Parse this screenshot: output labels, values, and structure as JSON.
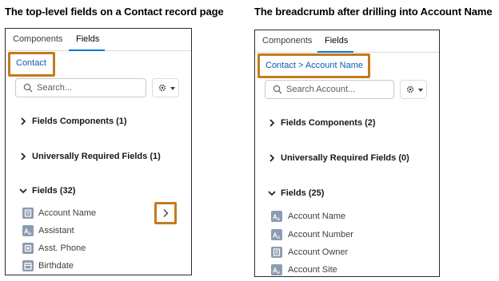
{
  "left": {
    "caption": "The top-level fields on a Contact record page",
    "tabs": [
      "Components",
      "Fields"
    ],
    "breadcrumb": "Contact",
    "search_placeholder": "Search...",
    "sections": [
      {
        "label": "Fields Components (1)",
        "expanded": false
      },
      {
        "label": "Universally Required Fields (1)",
        "expanded": false
      },
      {
        "label": "Fields (32)",
        "expanded": true
      }
    ],
    "fields": [
      {
        "label": "Account Name",
        "icon": "lookup-icon"
      },
      {
        "label": "Assistant",
        "icon": "text-icon"
      },
      {
        "label": "Asst. Phone",
        "icon": "phone-icon"
      },
      {
        "label": "Birthdate",
        "icon": "date-icon"
      }
    ]
  },
  "right": {
    "caption": "The breadcrumb after drilling into Account Name",
    "tabs": [
      "Components",
      "Fields"
    ],
    "breadcrumb": "Contact > Account Name",
    "search_placeholder": "Search Account...",
    "sections": [
      {
        "label": "Fields Components (2)",
        "expanded": false
      },
      {
        "label": "Universally Required Fields (0)",
        "expanded": false
      },
      {
        "label": "Fields (25)",
        "expanded": true
      }
    ],
    "fields": [
      {
        "label": "Account Name",
        "icon": "text-icon"
      },
      {
        "label": "Account Number",
        "icon": "text-icon"
      },
      {
        "label": "Account Owner",
        "icon": "lookup-icon"
      },
      {
        "label": "Account Site",
        "icon": "text-icon"
      }
    ]
  },
  "colors": {
    "accent": "#0176d3",
    "link": "#0b5cab",
    "highlight": "#c37a1e",
    "field_icon": "#8d9bb0"
  }
}
